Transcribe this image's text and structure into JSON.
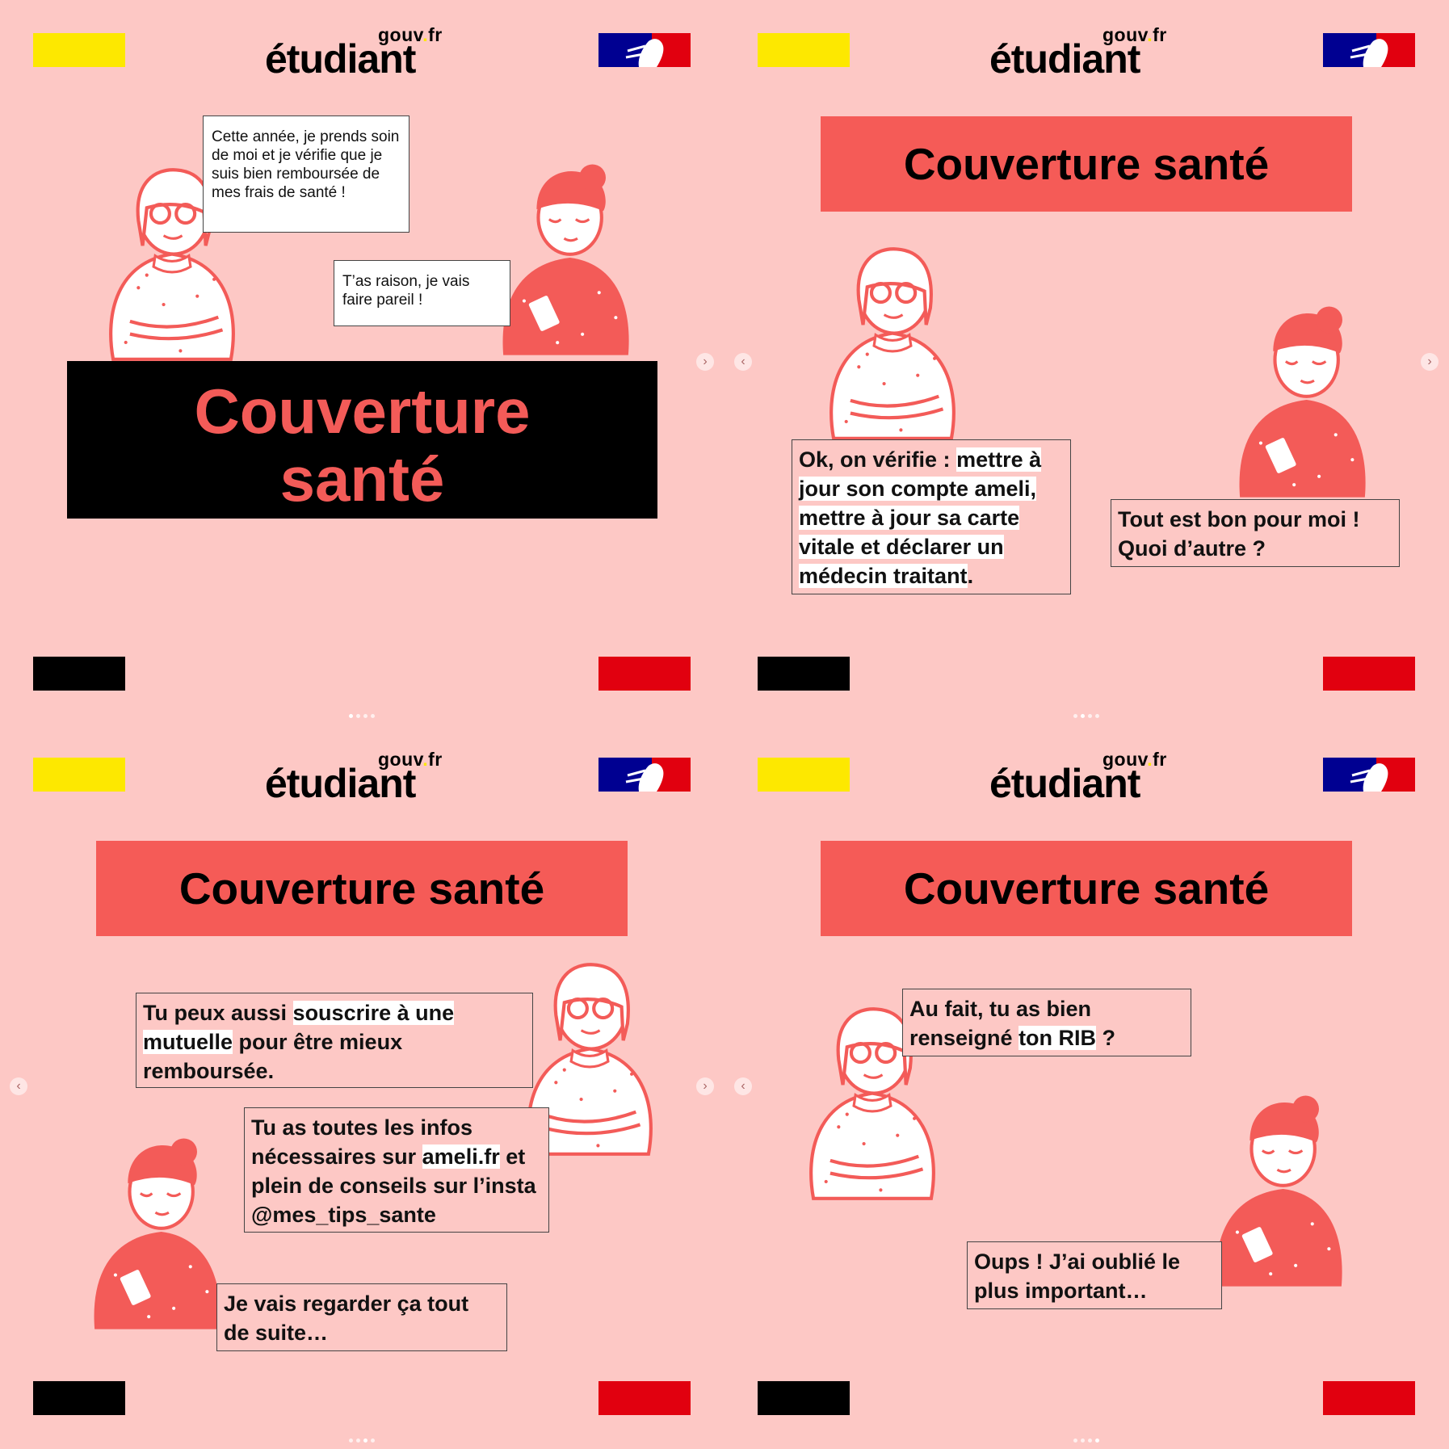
{
  "brand": {
    "gouv": "gouv",
    "dot": ".",
    "fr": "fr",
    "main": "étudiant"
  },
  "colors": {
    "yellow": "#fde800",
    "red": "#e1000f",
    "black": "#000000",
    "pink": "#fdc8c5",
    "coral": "#f55b57"
  },
  "panels": [
    {
      "title_line1": "Couverture",
      "title_line2": "santé",
      "bubble_a": "Cette année, je prends soin de moi et je vérifie que je suis bien remboursée de mes frais de santé !",
      "bubble_b": "T’as raison, je vais faire pareil !"
    },
    {
      "title": "Couverture santé",
      "bubble_a_pre": "Ok, on vérifie : ",
      "bubble_a_hl": "mettre à jour son compte ameli, mettre à jour sa carte vitale et déclarer un médecin traitant",
      "bubble_a_post": ".",
      "bubble_b": "Tout est bon pour moi ! Quoi d’autre ?"
    },
    {
      "title": "Couverture santé",
      "bubble_a_pre": "Tu peux aussi ",
      "bubble_a_hl": "souscrire à une mutuelle",
      "bubble_a_post": " pour être mieux remboursée.",
      "bubble_b_pre": "Tu as toutes les infos nécessaires sur ",
      "bubble_b_hl": "ameli.fr",
      "bubble_b_post": " et plein de conseils sur l’insta @mes_tips_sante",
      "bubble_c": "Je vais regarder ça tout de suite…"
    },
    {
      "title": "Couverture santé",
      "bubble_a_pre": "Au fait, tu as bien renseigné ",
      "bubble_a_hl": "ton RIB",
      "bubble_a_post": " ?",
      "bubble_b": "Oups ! J’ai oublié le plus important…"
    }
  ],
  "icons": {
    "prev": "‹",
    "next": "›"
  }
}
